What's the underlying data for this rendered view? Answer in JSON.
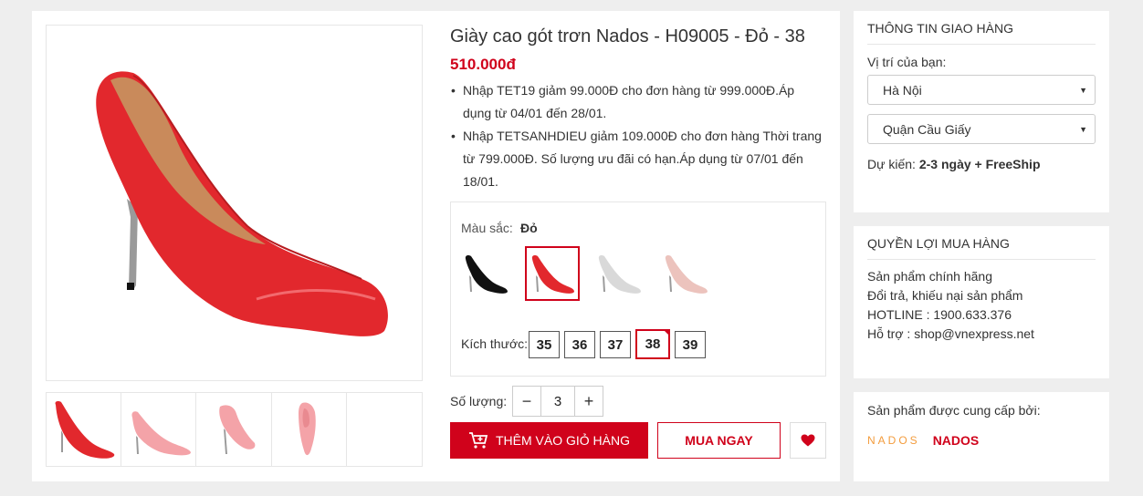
{
  "product": {
    "title": "Giày cao gót trơn Nados - H09005 - Đỏ - 38",
    "price": "510.000đ",
    "promos": [
      "Nhập TET19 giảm 99.000Đ cho đơn hàng từ 999.000Đ.Áp dụng từ 04/01 đến 28/01.",
      "Nhập TETSANHDIEU giảm 109.000Đ cho đơn hàng Thời trang từ 799.000Đ. Số lượng ưu đãi có hạn.Áp dụng từ 07/01 đến 18/01."
    ],
    "color_label": "Màu sắc:",
    "color_value": "Đỏ",
    "colors": [
      "black",
      "red",
      "silver",
      "nude"
    ],
    "size_label": "Kích thước:",
    "sizes": [
      "35",
      "36",
      "37",
      "38",
      "39"
    ],
    "selected_size": "38",
    "qty_label": "Số lượng:",
    "qty_minus": "−",
    "qty_value": "3",
    "qty_plus": "+",
    "add_to_cart": "THÊM VÀO GIỎ HÀNG",
    "buy_now": "MUA NGAY"
  },
  "colors": {
    "accent": "#d0021b",
    "red": "#e8363a",
    "pink": "#f4a3a8",
    "black": "#111111",
    "silver": "#d9d9d9",
    "nude": "#ecc3bd"
  },
  "delivery": {
    "title": "THÔNG TIN GIAO HÀNG",
    "location_label": "Vị trí của bạn:",
    "city": "Hà Nội",
    "district": "Quận Cầu Giấy",
    "eta_label": "Dự kiến:",
    "eta_value": "2-3 ngày + FreeShip"
  },
  "benefits": {
    "title": "QUYỀN LỢI MUA HÀNG",
    "lines": [
      "Sản phẩm chính hãng",
      "Đổi trả, khiếu nại sản phẩm",
      "HOTLINE : 1900.633.376",
      "Hỗ trợ : shop@vnexpress.net"
    ]
  },
  "supplier": {
    "label": "Sản phẩm được cung cấp bởi:",
    "logo_text": "NADOS",
    "name": "NADOS"
  },
  "icons": {
    "cart": "cart-icon",
    "heart": "heart-icon",
    "caret": "caret-down-icon"
  }
}
